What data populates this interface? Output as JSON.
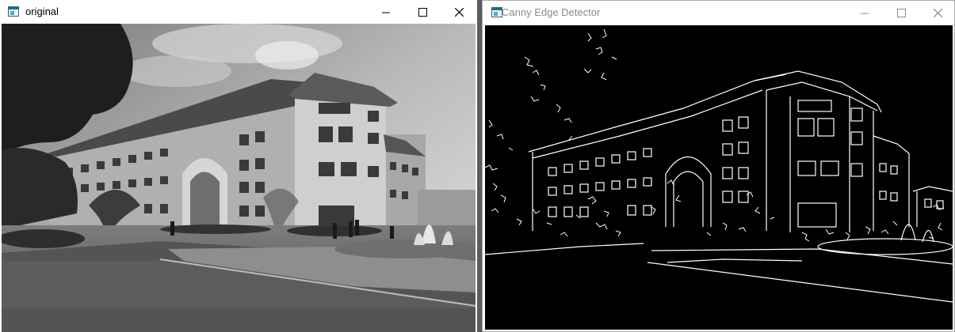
{
  "windows": {
    "original": {
      "title": "original",
      "icon": "window-icon",
      "controls": [
        "minimize-icon",
        "maximize-icon",
        "close-icon"
      ],
      "image": "grayscale photograph of a multi-story building with trees and a fountain"
    },
    "canny": {
      "title": "Canny Edge Detector",
      "icon": "window-icon",
      "controls": [
        "minimize-icon",
        "maximize-icon",
        "close-icon"
      ],
      "image": "white edge map on black background"
    }
  },
  "colors": {
    "desktop": "#5c5c5c",
    "titlebar": "#ffffff",
    "inactive_title_text": "#8a8a8a",
    "edge_background": "#000000",
    "edge_lines": "#ffffff"
  }
}
